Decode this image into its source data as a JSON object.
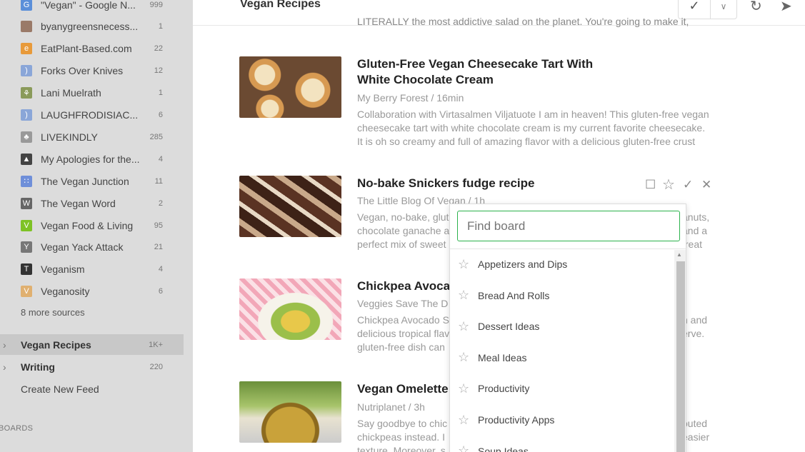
{
  "sidebar": {
    "sources": [
      {
        "name": "\"Vegan\" - Google N...",
        "count": "999",
        "icon": "google-news-icon",
        "color": "#5b8fd9"
      },
      {
        "name": "byanygreensnecess...",
        "count": "1",
        "icon": "avatar-icon",
        "color": "#9a7a68"
      },
      {
        "name": "EatPlant-Based.com",
        "count": "22",
        "icon": "eatplant-icon",
        "color": "#e89a3a"
      },
      {
        "name": "Forks Over Knives",
        "count": "12",
        "icon": "rss-icon",
        "color": "#8aa6d8"
      },
      {
        "name": "Lani Muelrath",
        "count": "1",
        "icon": "leaf-icon",
        "color": "#8a9a5a"
      },
      {
        "name": "LAUGHFRODISIAC...",
        "count": "6",
        "icon": "rss-icon",
        "color": "#8aa6d8"
      },
      {
        "name": "LIVEKINDLY",
        "count": "285",
        "icon": "livekindly-icon",
        "color": "#999"
      },
      {
        "name": "My Apologies for the...",
        "count": "4",
        "icon": "bird-icon",
        "color": "#444"
      },
      {
        "name": "The Vegan Junction",
        "count": "11",
        "icon": "dots-icon",
        "color": "#6f8fd9"
      },
      {
        "name": "The Vegan Word",
        "count": "2",
        "icon": "vw-icon",
        "color": "#666"
      },
      {
        "name": "Vegan Food & Living",
        "count": "95",
        "icon": "v-icon",
        "color": "#7ec225"
      },
      {
        "name": "Vegan Yack Attack",
        "count": "21",
        "icon": "yack-icon",
        "color": "#777"
      },
      {
        "name": "Veganism",
        "count": "4",
        "icon": "nyt-icon",
        "color": "#333"
      },
      {
        "name": "Veganosity",
        "count": "6",
        "icon": "veganosity-icon",
        "color": "#e0b070"
      }
    ],
    "more_sources": "8 more sources",
    "feeds": [
      {
        "name": "Vegan Recipes",
        "count": "1K+"
      },
      {
        "name": "Writing",
        "count": "220"
      }
    ],
    "create_feed": "Create New Feed",
    "boards_label": "BOARDS"
  },
  "header": {
    "title": "Vegan Recipes"
  },
  "cut_text": "LITERALLY the most addictive salad on the planet. You're going to make it,",
  "articles": [
    {
      "title_line1": "Gluten-Free Vegan Cheesecake Tart With",
      "title_line2": "White Chocolate Cream",
      "meta": "My Berry Forest / 16min",
      "summary_lines": [
        "Collaboration with Virtasalmen Viljatuote I am in heaven! This gluten-free vegan",
        "cheesecake tart with white chocolate cream is my current favorite cheesecake.",
        "It is oh so creamy and full of amazing flavor with a delicious gluten-free crust"
      ]
    },
    {
      "title_line1": "No-bake Snickers fudge recipe",
      "meta": "The Little Blog Of Vegan / 1h",
      "summary_lines": [
        "Vegan, no-bake, glut",
        "chocolate ganache a",
        "perfect mix of sweet"
      ],
      "summary_right": [
        "anuts,",
        "and a",
        "treat"
      ]
    },
    {
      "title_line1": "Chickpea Avocad",
      "meta": "Veggies Save The D",
      "summary_lines": [
        "Chickpea Avocado S",
        "delicious tropical flav",
        "gluten-free dish can"
      ],
      "summary_right": [
        "",
        "n and",
        "erve."
      ]
    },
    {
      "title_line1": "Vegan Omelette v",
      "meta": "Nutriplanet / 3h",
      "summary_lines": [
        "Say goodbye to chic",
        "chickpeas instead. I",
        "texture. Moreover, s"
      ],
      "summary_right": [
        "outed",
        "",
        "easier"
      ]
    }
  ],
  "board_popup": {
    "search_placeholder": "Find board",
    "boards": [
      "Appetizers and Dips",
      "Bread And Rolls",
      "Dessert Ideas",
      "Meal Ideas",
      "Productivity",
      "Productivity Apps",
      "Soup Ideas"
    ]
  }
}
